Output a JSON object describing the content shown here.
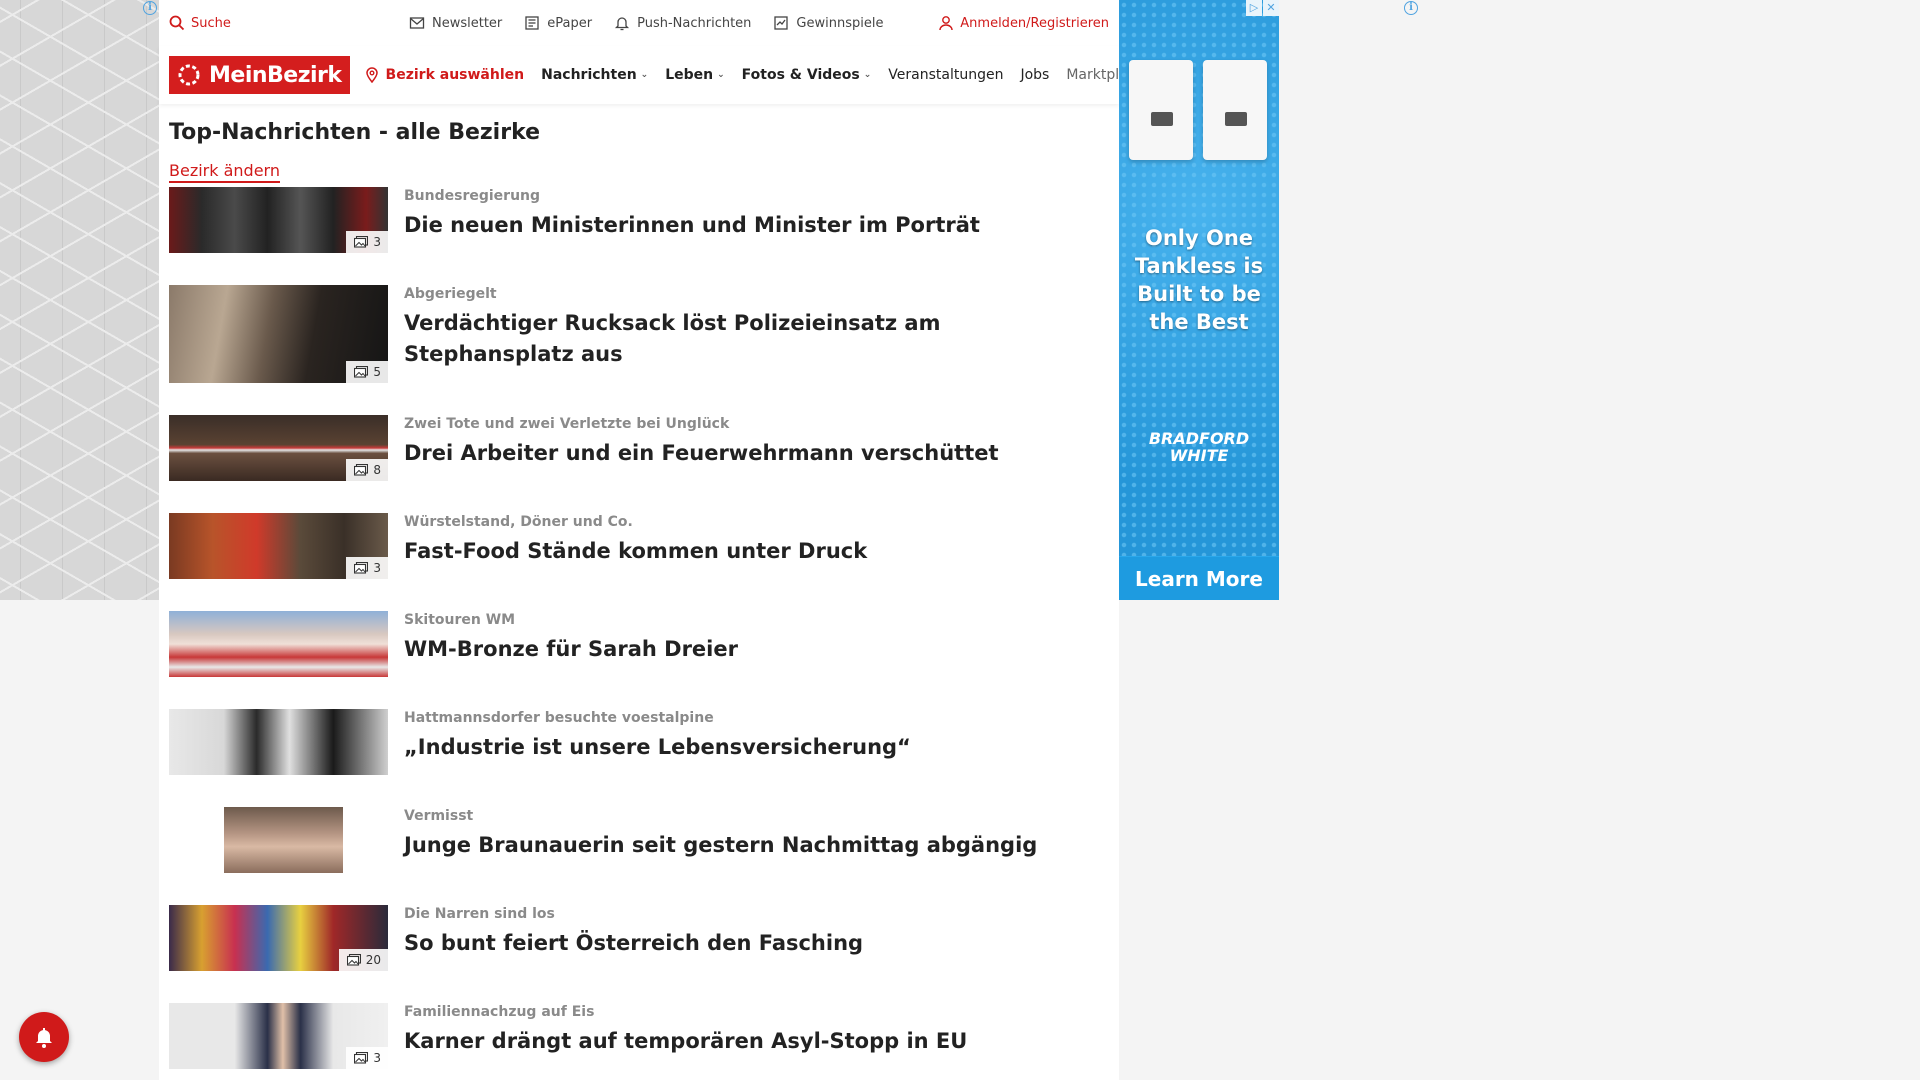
{
  "utility": {
    "search": "Suche",
    "newsletter": "Newsletter",
    "epaper": "ePaper",
    "push": "Push-Nachrichten",
    "contests": "Gewinnspiele",
    "login": "Anmelden/Registrieren"
  },
  "nav": {
    "logo": "MeinBezirk",
    "select_district": "Bezirk auswählen",
    "items": [
      {
        "label": "Nachrichten",
        "dropdown": true
      },
      {
        "label": "Leben",
        "dropdown": true
      },
      {
        "label": "Fotos & Videos",
        "dropdown": true
      },
      {
        "label": "Veranstaltungen",
        "dropdown": false
      },
      {
        "label": "Jobs",
        "dropdown": false
      },
      {
        "label": "Marktplatz",
        "dropdown": false
      }
    ]
  },
  "main": {
    "title": "Top-Nachrichten - alle Bezirke",
    "change_district": "Bezirk ändern",
    "articles": [
      {
        "kicker": "Bundesregierung",
        "title": "Die neuen Ministerinnen und Minister im Porträt",
        "photos": "3"
      },
      {
        "kicker": "Abgeriegelt",
        "title": "Verdächtiger Rucksack löst Polizeieinsatz am Stephansplatz aus",
        "photos": "5"
      },
      {
        "kicker": "Zwei Tote und zwei Verletzte bei Unglück",
        "title": "Drei Arbeiter und ein Feuerwehrmann verschüttet",
        "photos": "8"
      },
      {
        "kicker": "Würstelstand, Döner und Co.",
        "title": "Fast-Food Stände kommen unter Druck",
        "photos": "3"
      },
      {
        "kicker": "Skitouren WM",
        "title": "WM-Bronze für Sarah Dreier",
        "photos": ""
      },
      {
        "kicker": "Hattmannsdorfer besuchte voestalpine",
        "title": "„Industrie ist unsere Lebensversicherung“",
        "photos": ""
      },
      {
        "kicker": "Vermisst",
        "title": "Junge Braunauerin seit gestern Nachmittag abgängig",
        "photos": ""
      },
      {
        "kicker": "Die Narren sind los",
        "title": "So bunt feiert Österreich den Fasching",
        "photos": "20"
      },
      {
        "kicker": "Familiennachzug auf Eis",
        "title": "Karner drängt auf temporären Asyl-Stopp in EU",
        "photos": "3"
      }
    ]
  },
  "ad": {
    "headline": "Only One Tankless is Built to be the Best",
    "brand_line1": "BRADFORD",
    "brand_line2": "WHITE",
    "cta": "Learn More"
  },
  "colors": {
    "brand_red": "#d41e1e",
    "ad_blue": "#2596d8"
  }
}
